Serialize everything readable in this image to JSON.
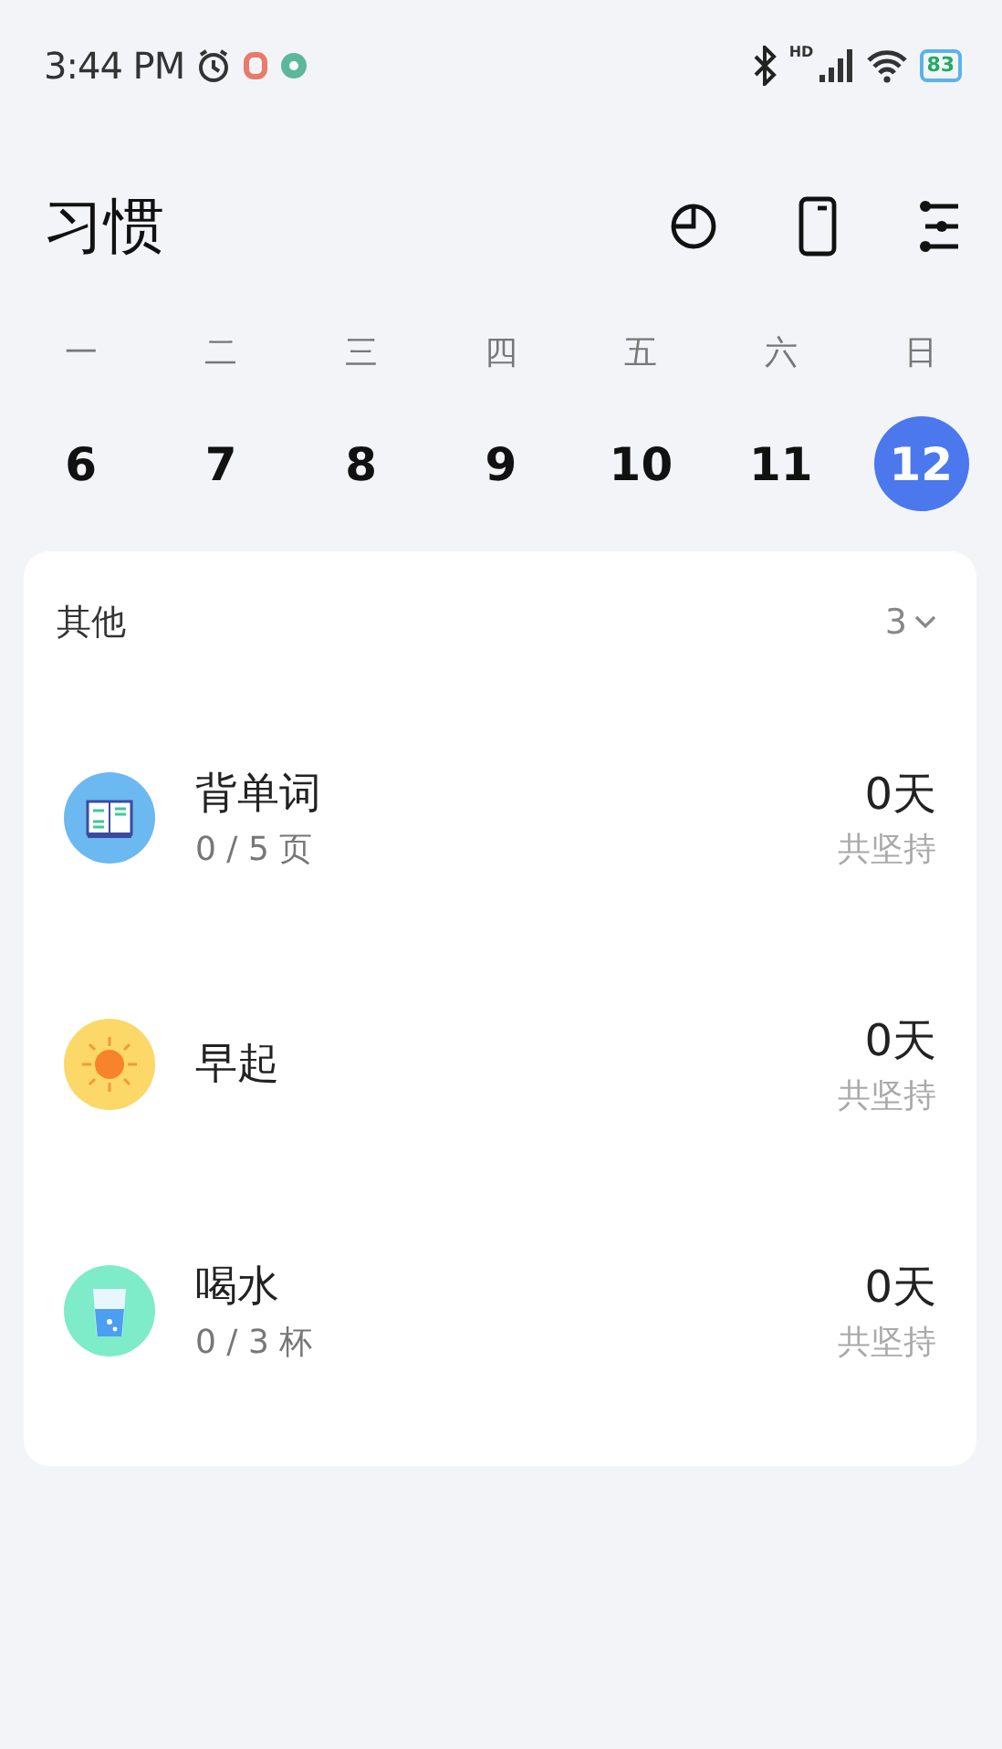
{
  "status_bar": {
    "time": "3:44 PM",
    "signal_label": "HD",
    "battery": "83"
  },
  "header": {
    "title": "习惯"
  },
  "week": [
    {
      "weekday": "一",
      "date": "6",
      "selected": false
    },
    {
      "weekday": "二",
      "date": "7",
      "selected": false
    },
    {
      "weekday": "三",
      "date": "8",
      "selected": false
    },
    {
      "weekday": "四",
      "date": "9",
      "selected": false
    },
    {
      "weekday": "五",
      "date": "10",
      "selected": false
    },
    {
      "weekday": "六",
      "date": "11",
      "selected": false
    },
    {
      "weekday": "日",
      "date": "12",
      "selected": true
    }
  ],
  "group": {
    "title": "其他",
    "count": "3",
    "habits": [
      {
        "kind": "book",
        "color": "#6cb8f0",
        "name": "背单词",
        "progress": "0 / 5 页",
        "streak": "0天",
        "streak_label": "共坚持"
      },
      {
        "kind": "sun",
        "color": "#fbd867",
        "name": "早起",
        "streak": "0天",
        "streak_label": "共坚持"
      },
      {
        "kind": "water",
        "color": "#7eebc9",
        "name": "喝水",
        "progress": "0 / 3 杯",
        "streak": "0天",
        "streak_label": "共坚持"
      }
    ]
  }
}
